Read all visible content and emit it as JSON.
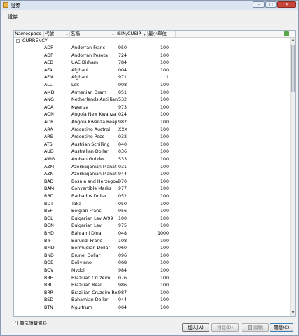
{
  "window": {
    "title": "證券",
    "buttons": {
      "minimize": "–",
      "maximize": "□",
      "close": "✕"
    }
  },
  "section_label": "證券",
  "grid": {
    "columns": [
      "Namespace",
      "代號",
      "名稱",
      "ISIN/CUSIP",
      "最小單位"
    ],
    "group": "CURRENCY",
    "rows": [
      {
        "code": "ADF",
        "name": "Andorran Franc",
        "isin": "950",
        "unit": "100"
      },
      {
        "code": "ADP",
        "name": "Andorran Peseta",
        "isin": "724",
        "unit": "100"
      },
      {
        "code": "AED",
        "name": "UAE Dirham",
        "isin": "784",
        "unit": "100"
      },
      {
        "code": "AFA",
        "name": "Afghani",
        "isin": "004",
        "unit": "100"
      },
      {
        "code": "AFN",
        "name": "Afghani",
        "isin": "971",
        "unit": "1"
      },
      {
        "code": "ALL",
        "name": "Lek",
        "isin": "008",
        "unit": "100"
      },
      {
        "code": "AMD",
        "name": "Armenian Dram",
        "isin": "051",
        "unit": "100"
      },
      {
        "code": "ANG",
        "name": "Netherlands Antillian Guilc",
        "isin": "532",
        "unit": "100"
      },
      {
        "code": "AOA",
        "name": "Kwanza",
        "isin": "973",
        "unit": "100"
      },
      {
        "code": "AON",
        "name": "Angola New Kwanza",
        "isin": "024",
        "unit": "100"
      },
      {
        "code": "AOR",
        "name": "Angola Kwanza Reajustad",
        "isin": "982",
        "unit": "100"
      },
      {
        "code": "ARA",
        "name": "Argentine Austral",
        "isin": "XXX",
        "unit": "100"
      },
      {
        "code": "ARS",
        "name": "Argentine Peso",
        "isin": "032",
        "unit": "100"
      },
      {
        "code": "ATS",
        "name": "Austrian Schilling",
        "isin": "040",
        "unit": "100"
      },
      {
        "code": "AUD",
        "name": "Australian Dollar",
        "isin": "036",
        "unit": "100"
      },
      {
        "code": "AWG",
        "name": "Aruban Guilder",
        "isin": "533",
        "unit": "100"
      },
      {
        "code": "AZM",
        "name": "Azerbaijanian Manat",
        "isin": "031",
        "unit": "100"
      },
      {
        "code": "AZN",
        "name": "Azerbaijanian Manat",
        "isin": "944",
        "unit": "100"
      },
      {
        "code": "BAD",
        "name": "Bosnia and Herzegovina D",
        "isin": "070",
        "unit": "100"
      },
      {
        "code": "BAM",
        "name": "Convertible Marks",
        "isin": "977",
        "unit": "100"
      },
      {
        "code": "BBD",
        "name": "Barbados Dollar",
        "isin": "052",
        "unit": "100"
      },
      {
        "code": "BDT",
        "name": "Taka",
        "isin": "050",
        "unit": "100"
      },
      {
        "code": "BEF",
        "name": "Belgian Franc",
        "isin": "056",
        "unit": "100"
      },
      {
        "code": "BGL",
        "name": "Bulgarian Lev A/99",
        "isin": "100",
        "unit": "100"
      },
      {
        "code": "BGN",
        "name": "Bulgarian Lev",
        "isin": "975",
        "unit": "100"
      },
      {
        "code": "BHD",
        "name": "Bahraini Dinar",
        "isin": "048",
        "unit": "1000"
      },
      {
        "code": "BIF",
        "name": "Burundi Franc",
        "isin": "108",
        "unit": "100"
      },
      {
        "code": "BMD",
        "name": "Bermudian Dollar",
        "isin": "060",
        "unit": "100"
      },
      {
        "code": "BND",
        "name": "Brunei Dollar",
        "isin": "096",
        "unit": "100"
      },
      {
        "code": "BOB",
        "name": "Boliviano",
        "isin": "068",
        "unit": "100"
      },
      {
        "code": "BOV",
        "name": "Mvdol",
        "isin": "984",
        "unit": "100"
      },
      {
        "code": "BRE",
        "name": "Brazilian Cruzeiro",
        "isin": "076",
        "unit": "100"
      },
      {
        "code": "BRL",
        "name": "Brazilian Real",
        "isin": "986",
        "unit": "100"
      },
      {
        "code": "BRR",
        "name": "Brazilian Cruzeiro Real",
        "isin": "987",
        "unit": "100"
      },
      {
        "code": "BSD",
        "name": "Bahamian Dollar",
        "isin": "044",
        "unit": "100"
      },
      {
        "code": "BTN",
        "name": "Ngultrum",
        "isin": "064",
        "unit": "100"
      }
    ]
  },
  "checkbox": {
    "label": "顯示隱藏資料",
    "checked": "✓"
  },
  "buttons": {
    "add": "加入(A)",
    "remove": "移除(D)",
    "edit": "編輯",
    "close": "關閉(C)"
  },
  "colors": {
    "accent": "#3c7fb1",
    "export_icon": "#5aa845"
  }
}
